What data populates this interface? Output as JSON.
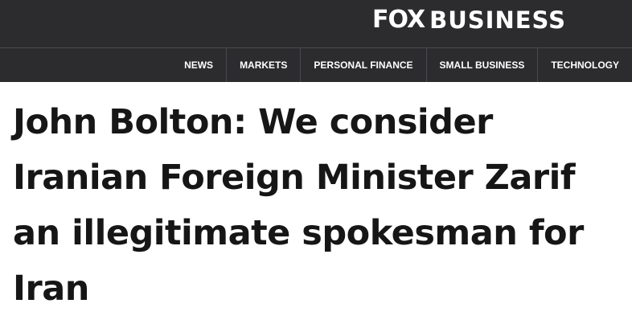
{
  "header": {
    "logo": {
      "fox_text": "FOX",
      "business_text": "BUSINESS"
    },
    "nav": [
      {
        "label": "NEWS"
      },
      {
        "label": "MARKETS"
      },
      {
        "label": "PERSONAL FINANCE"
      },
      {
        "label": "SMALL BUSINESS"
      },
      {
        "label": "TECHNOLOGY"
      }
    ]
  },
  "article": {
    "headline": "John Bolton: We consider Iranian Foreign Minister Zarif an illegitimate spokesman for Iran"
  },
  "colors": {
    "header_bg": "#2c2c2f",
    "divider": "#4a4a4e",
    "headline_text": "#161616"
  }
}
